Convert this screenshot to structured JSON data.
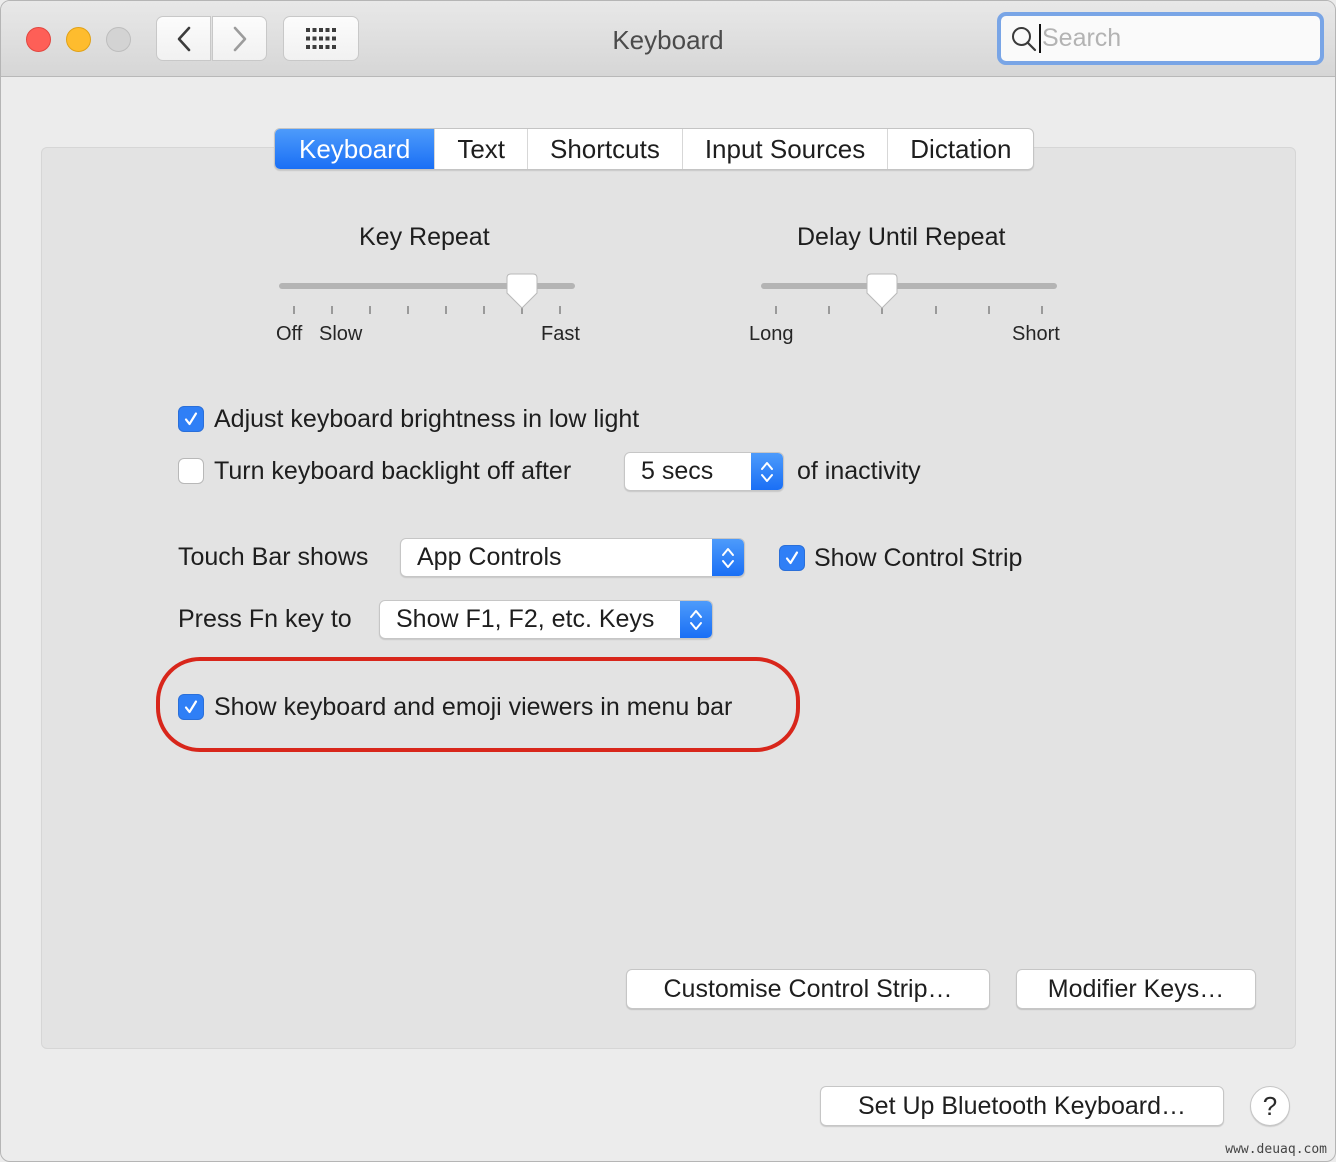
{
  "window": {
    "title": "Keyboard",
    "traffic_lights": [
      "close",
      "minimize",
      "zoom"
    ],
    "nav": {
      "back_icon": "chevron-left-icon",
      "forward_icon": "chevron-right-icon",
      "grid_icon": "show-all-grid-icon"
    },
    "search": {
      "placeholder": "Search",
      "value": ""
    }
  },
  "tabs": [
    {
      "label": "Keyboard",
      "active": true
    },
    {
      "label": "Text",
      "active": false
    },
    {
      "label": "Shortcuts",
      "active": false
    },
    {
      "label": "Input Sources",
      "active": false
    },
    {
      "label": "Dictation",
      "active": false
    }
  ],
  "key_repeat": {
    "title": "Key Repeat",
    "labels": {
      "off": "Off",
      "slow": "Slow",
      "fast": "Fast"
    },
    "ticks": 8,
    "value_step": 7
  },
  "delay_until_repeat": {
    "title": "Delay Until Repeat",
    "labels": {
      "long": "Long",
      "short": "Short"
    },
    "ticks": 6,
    "value_step": 3
  },
  "options": {
    "adjust_brightness": {
      "label": "Adjust keyboard brightness in low light",
      "checked": true
    },
    "backlight_off": {
      "label": "Turn keyboard backlight off after",
      "checked": false,
      "popup_value": "5 secs",
      "suffix": "of inactivity"
    },
    "touch_bar": {
      "label": "Touch Bar shows",
      "popup_value": "App Controls"
    },
    "show_control_strip": {
      "label": "Show Control Strip",
      "checked": true
    },
    "fn_key": {
      "label": "Press Fn key to",
      "popup_value": "Show F1, F2, etc. Keys"
    },
    "show_viewers": {
      "label": "Show keyboard and emoji viewers in menu bar",
      "checked": true
    }
  },
  "buttons": {
    "customise_control_strip": "Customise Control Strip…",
    "modifier_keys": "Modifier Keys…",
    "bluetooth_keyboard": "Set Up Bluetooth Keyboard…",
    "help": "?"
  },
  "annotation": {
    "color": "#d8261b",
    "target": "show_viewers"
  },
  "colors": {
    "accent": "#1a6ff5",
    "panel": "#e3e3e3",
    "window": "#ececec"
  },
  "watermark": "www.deuaq.com"
}
